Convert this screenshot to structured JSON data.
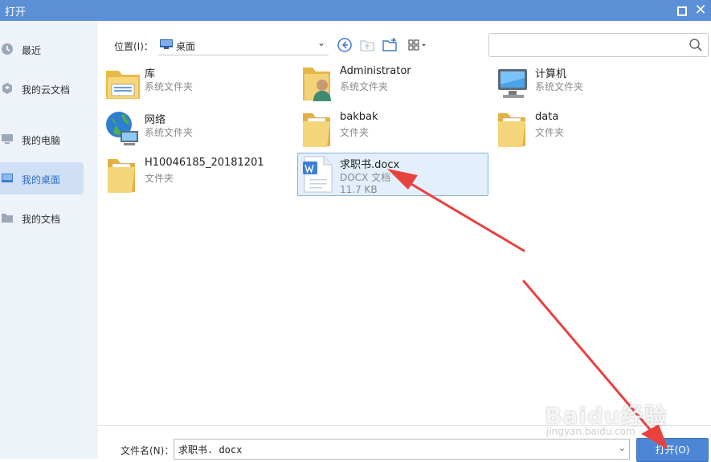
{
  "window": {
    "title": "打开",
    "maximize_icon": "square-icon",
    "close_icon": "close-icon",
    "accent": "#5b8fd6"
  },
  "sidebar": {
    "items": [
      {
        "label": "最近",
        "icon": "clock-icon"
      },
      {
        "label": "我的云文档",
        "icon": "cloud-doc-icon"
      },
      {
        "label": "我的电脑",
        "icon": "computer-icon"
      },
      {
        "label": "我的桌面",
        "icon": "desktop-icon",
        "selected": true
      },
      {
        "label": "我的文档",
        "icon": "folder-icon"
      }
    ]
  },
  "toolbar": {
    "location_label": "位置(I)：",
    "location_value": "桌面",
    "search_placeholder": ""
  },
  "files": [
    {
      "name": "库",
      "type": "系统文件夹",
      "icon": "library-folder-icon"
    },
    {
      "name": "Administrator",
      "type": "系统文件夹",
      "icon": "user-folder-icon"
    },
    {
      "name": "计算机",
      "type": "系统文件夹",
      "icon": "computer-icon"
    },
    {
      "name": "网络",
      "type": "系统文件夹",
      "icon": "network-globe-icon"
    },
    {
      "name": "bakbak",
      "type": "文件夹",
      "icon": "folder-icon"
    },
    {
      "name": "data",
      "type": "文件夹",
      "icon": "folder-icon"
    },
    {
      "name": "H10046185_20181201",
      "type": "文件夹",
      "icon": "folder-icon"
    },
    {
      "name": "求职书.docx",
      "type": "DOCX 文档",
      "size": "11.7 KB",
      "icon": "wps-doc-icon",
      "selected": true
    }
  ],
  "footer": {
    "filename_label": "文件名(N)：",
    "filename_value": "求职书. docx",
    "open_label": "打开(O)"
  },
  "watermark": {
    "brand": "Baidu经验",
    "sub": "jingyan.baidu.com"
  },
  "colors": {
    "selection": "#e3effc",
    "arrow": "#e8423f",
    "button": "#4e86d6"
  }
}
